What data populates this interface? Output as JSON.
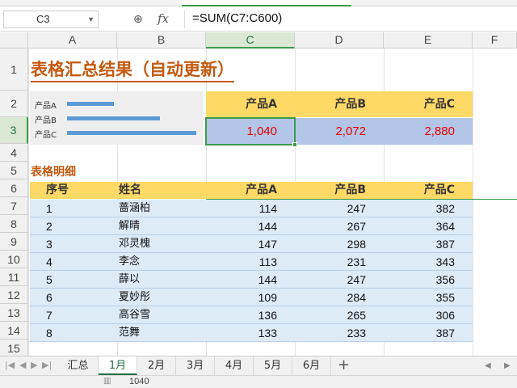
{
  "formula_bar": {
    "cell_ref": "C3",
    "formula": "=SUM(C7:C600)",
    "fx_label": "fx"
  },
  "columns": [
    "A",
    "B",
    "C",
    "D",
    "E",
    "F"
  ],
  "rows": [
    "1",
    "2",
    "3",
    "4",
    "5",
    "6",
    "7",
    "8",
    "9",
    "10",
    "11",
    "12",
    "13",
    "14",
    "15"
  ],
  "sheet": {
    "title": "表格汇总结果（自动更新）",
    "subtitle": "表格明细"
  },
  "mini_chart": {
    "labels": [
      "产品A",
      "产品B",
      "产品C"
    ],
    "values": [
      1040,
      2072,
      2880
    ]
  },
  "summary": {
    "headers": [
      "产品A",
      "产品B",
      "产品C"
    ],
    "values": [
      "1,040",
      "2,072",
      "2,880"
    ]
  },
  "detail": {
    "headers": [
      "序号",
      "姓名",
      "产品A",
      "产品B",
      "产品C"
    ],
    "rows": [
      [
        "1",
        "蔷涵柏",
        "114",
        "247",
        "382"
      ],
      [
        "2",
        "解晴",
        "144",
        "267",
        "364"
      ],
      [
        "3",
        "邓灵槐",
        "147",
        "298",
        "387"
      ],
      [
        "4",
        "李念",
        "113",
        "231",
        "343"
      ],
      [
        "5",
        "薛以",
        "144",
        "247",
        "356"
      ],
      [
        "6",
        "夏妙彤",
        "109",
        "284",
        "355"
      ],
      [
        "7",
        "高谷雪",
        "136",
        "265",
        "306"
      ],
      [
        "8",
        "范舞",
        "133",
        "233",
        "387"
      ]
    ]
  },
  "tabs": [
    "汇总",
    "1月",
    "2月",
    "3月",
    "4月",
    "5月",
    "6月"
  ],
  "active_tab": "1月",
  "add_tab_label": "+",
  "status": {
    "sum": "1040"
  },
  "colors": {
    "accent": "#217346",
    "title": "#c55a11",
    "header_fill": "#ffd966",
    "value_fill": "#b4c6e7",
    "row_fill": "#ddebf7",
    "bar": "#5b9bd5",
    "value_text": "#e00000"
  }
}
